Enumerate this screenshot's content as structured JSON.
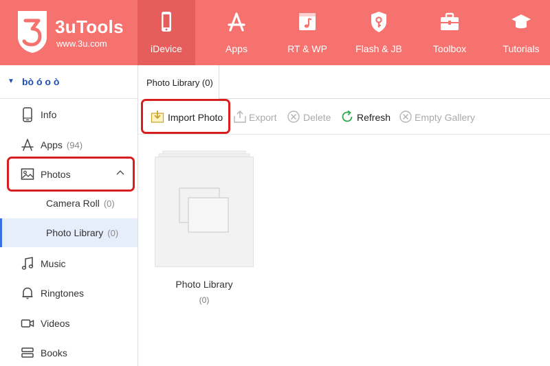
{
  "app": {
    "logo_title": "3uTools",
    "logo_url": "www.3u.com",
    "brand_color": "#f5726f",
    "active_nav_color": "#e55e5c"
  },
  "nav": {
    "idevice": "iDevice",
    "apps": "Apps",
    "rtwp": "RT & WP",
    "flashjb": "Flash & JB",
    "toolbox": "Toolbox",
    "tutorials": "Tutorials"
  },
  "sidebar": {
    "device_name": "bò ó o ò",
    "info": "Info",
    "apps": "Apps",
    "apps_count": "(94)",
    "photos": "Photos",
    "camera_roll": "Camera Roll",
    "camera_roll_count": "(0)",
    "photo_library": "Photo Library",
    "photo_library_count": "(0)",
    "music": "Music",
    "ringtones": "Ringtones",
    "videos": "Videos",
    "books": "Books"
  },
  "tabs": {
    "photo_library": "Photo Library (0)"
  },
  "toolbar": {
    "import": "Import Photo",
    "export": "Export",
    "delete": "Delete",
    "refresh": "Refresh",
    "empty": "Empty Gallery"
  },
  "album": {
    "title": "Photo Library",
    "count": "(0)"
  }
}
